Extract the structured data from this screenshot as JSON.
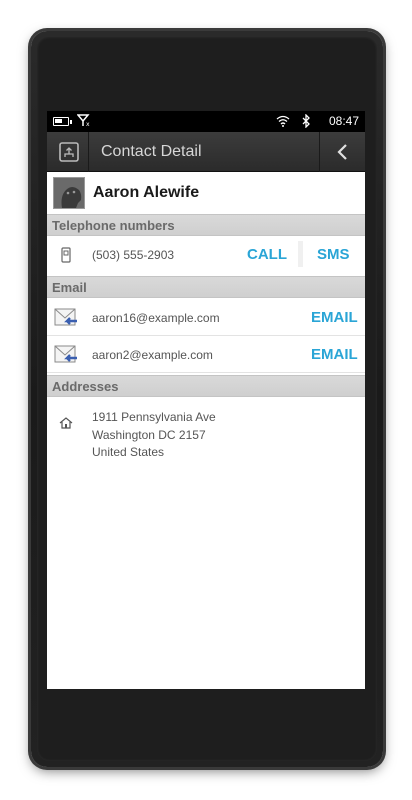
{
  "status_bar": {
    "time": "08:47"
  },
  "header": {
    "title": "Contact Detail"
  },
  "contact": {
    "name": "Aaron Alewife"
  },
  "sections": {
    "telephone": "Telephone numbers",
    "email": "Email",
    "addresses": "Addresses"
  },
  "phone": {
    "number": "(503) 555-2903",
    "call_label": "CALL",
    "sms_label": "SMS"
  },
  "emails": [
    {
      "address": "aaron16@example.com",
      "action": "EMAIL"
    },
    {
      "address": "aaron2@example.com",
      "action": "EMAIL"
    }
  ],
  "address": {
    "line1": "1911 Pennsylvania Ave",
    "line2": "Washington DC 2157",
    "line3": "United States"
  },
  "colors": {
    "accent": "#2aa5d6",
    "section_bg": "#d4d4d4",
    "header_bg": "#333333"
  }
}
